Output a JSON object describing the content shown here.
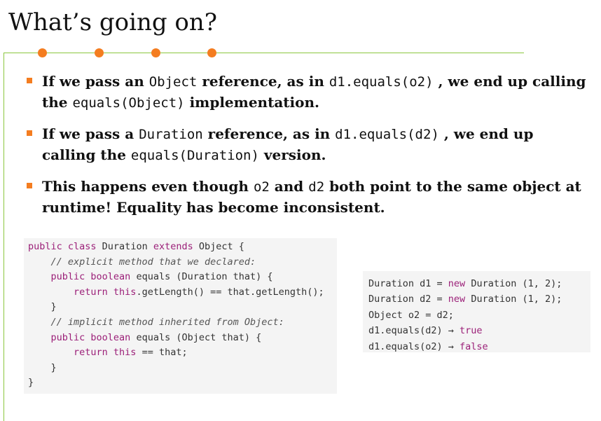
{
  "slide": {
    "title": "What’s going on?",
    "accent_colors": {
      "line": "#8cc63f",
      "dots": "#f47d20",
      "keyword": "#9b1f78"
    }
  },
  "bullets": [
    {
      "parts": [
        {
          "t": "If we pass an ",
          "mono": false
        },
        {
          "t": "Object",
          "mono": true
        },
        {
          "t": " reference, as in ",
          "mono": false
        },
        {
          "t": "d1.equals(o2)",
          "mono": true
        },
        {
          "t": " , we end up calling the ",
          "mono": false
        },
        {
          "t": "equals(Object)",
          "mono": true
        },
        {
          "t": " implementation.",
          "mono": false
        }
      ]
    },
    {
      "parts": [
        {
          "t": "If we pass a ",
          "mono": false
        },
        {
          "t": "Duration",
          "mono": true
        },
        {
          "t": " reference, as in ",
          "mono": false
        },
        {
          "t": "d1.equals(d2)",
          "mono": true
        },
        {
          "t": " , we end up calling the ",
          "mono": false
        },
        {
          "t": "equals(Duration)",
          "mono": true
        },
        {
          "t": " version.",
          "mono": false
        }
      ]
    },
    {
      "parts": [
        {
          "t": "This happens even though ",
          "mono": false
        },
        {
          "t": "o2",
          "mono": true
        },
        {
          "t": "  and ",
          "mono": false
        },
        {
          "t": "d2",
          "mono": true
        },
        {
          "t": " both point to the same object at runtime! Equality has become inconsistent.",
          "mono": false
        }
      ]
    }
  ],
  "code_left": [
    [
      {
        "t": "public class",
        "c": "kw"
      },
      {
        "t": " Duration ",
        "c": "pl"
      },
      {
        "t": "extends",
        "c": "kw"
      },
      {
        "t": " Object {",
        "c": "pl"
      }
    ],
    [
      {
        "t": "    // explicit method that we declared:",
        "c": "cm"
      }
    ],
    [
      {
        "t": "    ",
        "c": "pl"
      },
      {
        "t": "public boolean",
        "c": "kw"
      },
      {
        "t": " equals (Duration that) {",
        "c": "pl"
      }
    ],
    [
      {
        "t": "        ",
        "c": "pl"
      },
      {
        "t": "return this",
        "c": "kw"
      },
      {
        "t": ".getLength() == that.getLength();",
        "c": "pl"
      }
    ],
    [
      {
        "t": "    }",
        "c": "pl"
      }
    ],
    [
      {
        "t": "    // implicit method inherited from Object:",
        "c": "cm"
      }
    ],
    [
      {
        "t": "    ",
        "c": "pl"
      },
      {
        "t": "public boolean",
        "c": "kw"
      },
      {
        "t": " equals (Object that) {",
        "c": "pl"
      }
    ],
    [
      {
        "t": "        ",
        "c": "pl"
      },
      {
        "t": "return this",
        "c": "kw"
      },
      {
        "t": " == that;",
        "c": "pl"
      }
    ],
    [
      {
        "t": "    }",
        "c": "pl"
      }
    ],
    [
      {
        "t": "}",
        "c": "pl"
      }
    ]
  ],
  "code_right": [
    [
      {
        "t": "Duration d1 = ",
        "c": "pl"
      },
      {
        "t": "new",
        "c": "kw"
      },
      {
        "t": " Duration (1, 2);",
        "c": "pl"
      }
    ],
    [
      {
        "t": "Duration d2 = ",
        "c": "pl"
      },
      {
        "t": "new",
        "c": "kw"
      },
      {
        "t": " Duration (1, 2);",
        "c": "pl"
      }
    ],
    [
      {
        "t": "Object o2 = d2;",
        "c": "pl"
      }
    ],
    [
      {
        "t": "d1.equals(d2) → ",
        "c": "pl"
      },
      {
        "t": "true",
        "c": "kw"
      }
    ],
    [
      {
        "t": "d1.equals(o2) → ",
        "c": "pl"
      },
      {
        "t": "false",
        "c": "kw"
      }
    ]
  ]
}
